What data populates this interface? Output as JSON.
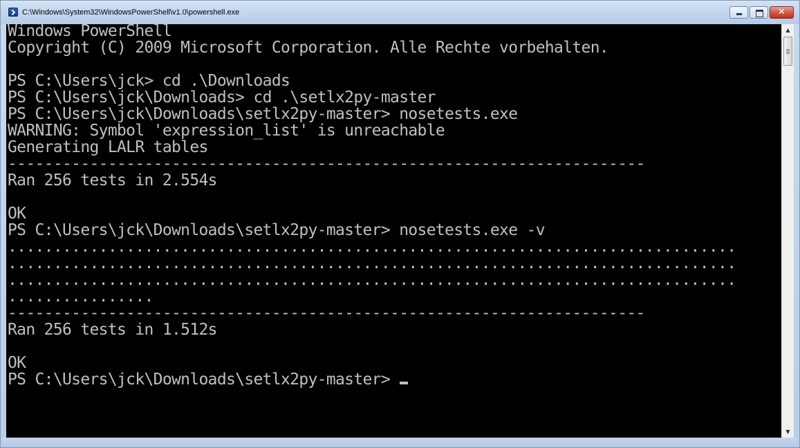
{
  "window": {
    "title": "C:\\Windows\\System32\\WindowsPowerShell\\v1.0\\powershell.exe",
    "icon": "powershell-icon",
    "buttons": {
      "minimize": "minimize-icon",
      "maximize": "maximize-icon",
      "close": "close-icon",
      "close_glyph": "✕"
    }
  },
  "colors": {
    "console_background": "#000000",
    "console_text": "#c0c0c0",
    "close_button": "#c0301a"
  },
  "console": {
    "lines": [
      "Windows PowerShell",
      "Copyright (C) 2009 Microsoft Corporation. Alle Rechte vorbehalten.",
      "",
      "PS C:\\Users\\jck> cd .\\Downloads",
      "PS C:\\Users\\jck\\Downloads> cd .\\setlx2py-master",
      "PS C:\\Users\\jck\\Downloads\\setlx2py-master> nosetests.exe",
      "WARNING: Symbol 'expression_list' is unreachable",
      "Generating LALR tables",
      "----------------------------------------------------------------------",
      "Ran 256 tests in 2.554s",
      "",
      "OK",
      "PS C:\\Users\\jck\\Downloads\\setlx2py-master> nosetests.exe -v",
      "................................................................................",
      "................................................................................",
      "................................................................................",
      "................",
      "----------------------------------------------------------------------",
      "Ran 256 tests in 1.512s",
      "",
      "OK",
      "PS C:\\Users\\jck\\Downloads\\setlx2py-master> "
    ]
  },
  "scrollbar": {
    "up_arrow": "▲",
    "down_arrow": "▼"
  }
}
